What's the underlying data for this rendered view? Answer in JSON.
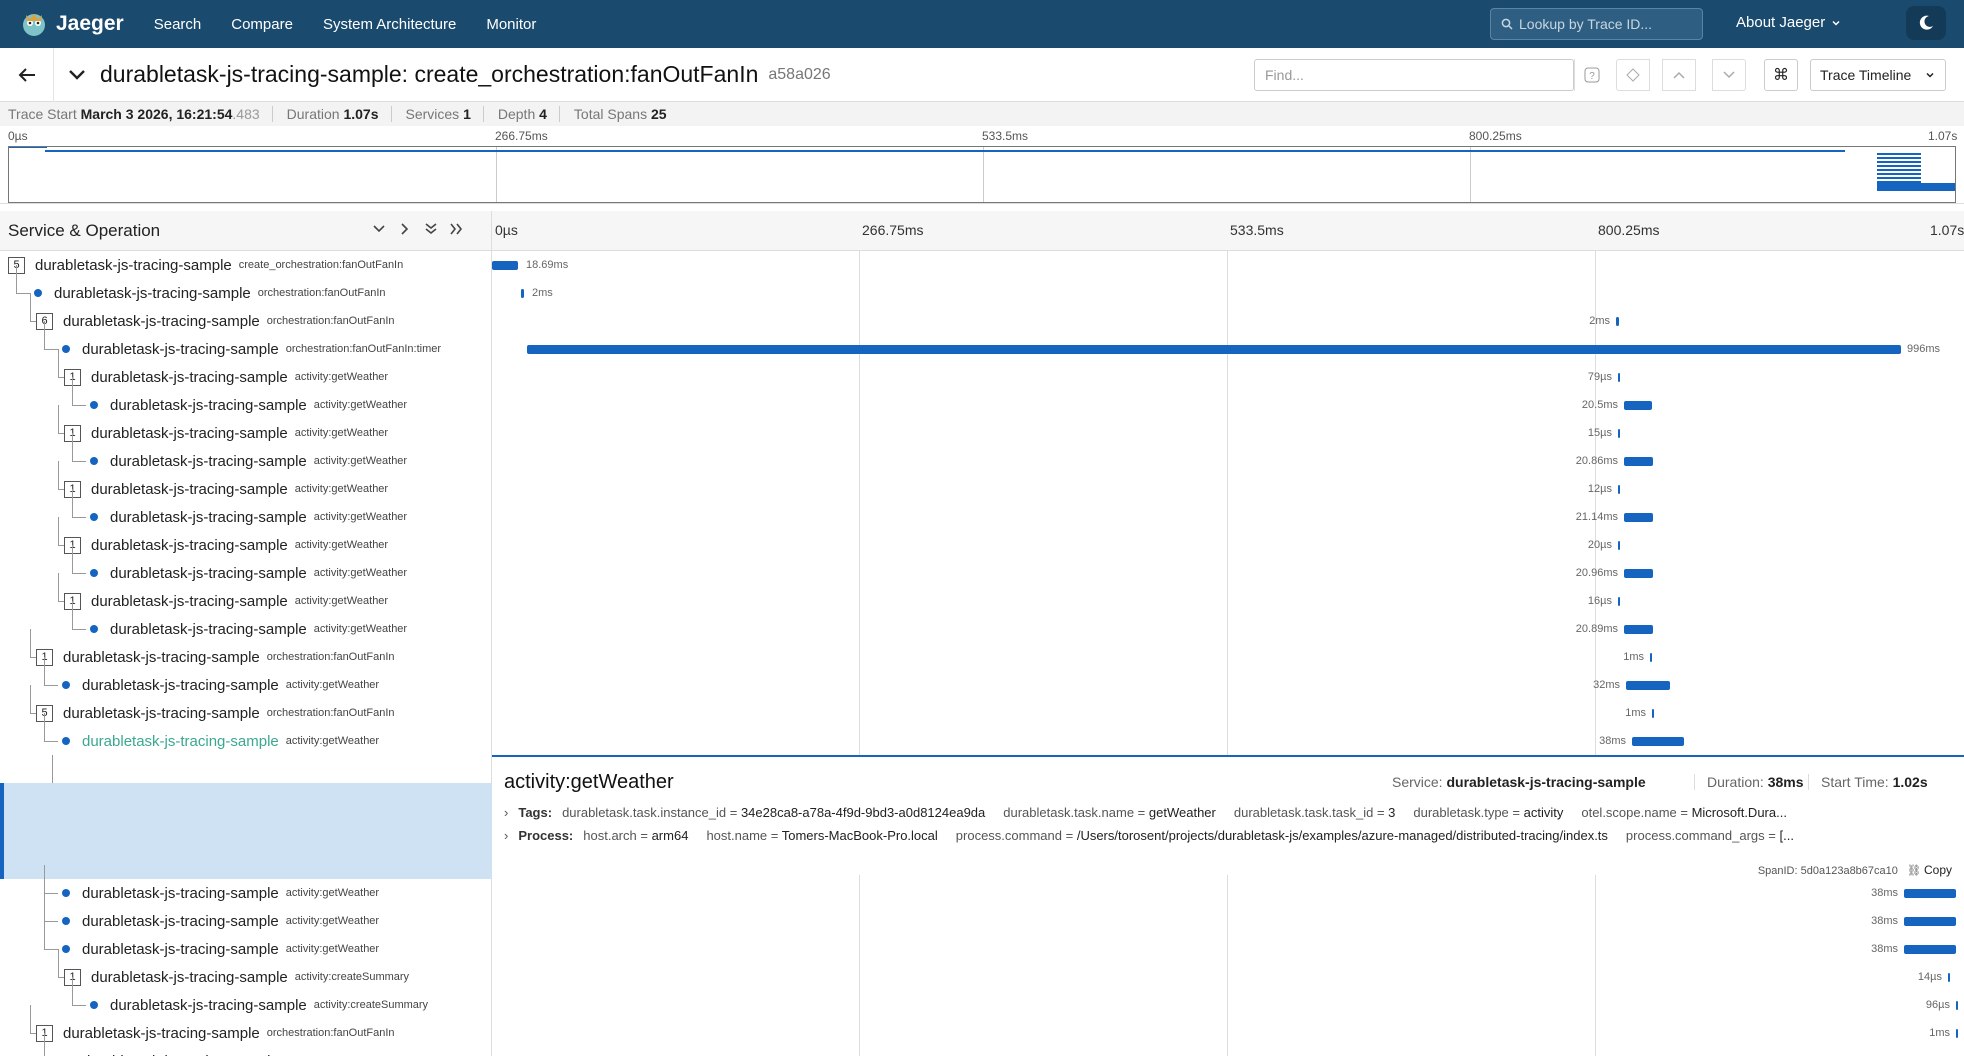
{
  "nav": {
    "brand": "Jaeger",
    "links": [
      "Search",
      "Compare",
      "System Architecture",
      "Monitor"
    ],
    "lookup_placeholder": "Lookup by Trace ID...",
    "about": "About Jaeger"
  },
  "header": {
    "title": "durabletask-js-tracing-sample: create_orchestration:fanOutFanIn",
    "trace_id": "a58a026",
    "find_placeholder": "Find...",
    "view": "Trace Timeline"
  },
  "meta": {
    "trace_start_label": "Trace Start",
    "trace_start": "March 3 2026, 16:21:54",
    "trace_start_ms": ".483",
    "duration_label": "Duration",
    "duration": "1.07s",
    "services_label": "Services",
    "services": "1",
    "depth_label": "Depth",
    "depth": "4",
    "spans_label": "Total Spans",
    "spans": "25"
  },
  "ticks": [
    "0µs",
    "266.75ms",
    "533.5ms",
    "800.25ms",
    "1.07s"
  ],
  "left_header": "Service & Operation",
  "rows": [
    {
      "svc": "durabletask-js-tracing-sample",
      "op": "create_orchestration:fanOutFanIn",
      "badge": "5",
      "dur": "18.69ms"
    },
    {
      "svc": "durabletask-js-tracing-sample",
      "op": "orchestration:fanOutFanIn",
      "dur": "2ms"
    },
    {
      "svc": "durabletask-js-tracing-sample",
      "op": "orchestration:fanOutFanIn",
      "badge": "6",
      "dur": "2ms"
    },
    {
      "svc": "durabletask-js-tracing-sample",
      "op": "orchestration:fanOutFanIn:timer",
      "dur": "996ms"
    },
    {
      "svc": "durabletask-js-tracing-sample",
      "op": "activity:getWeather",
      "badge": "1",
      "dur": "79µs"
    },
    {
      "svc": "durabletask-js-tracing-sample",
      "op": "activity:getWeather",
      "dur": "20.5ms"
    },
    {
      "svc": "durabletask-js-tracing-sample",
      "op": "activity:getWeather",
      "badge": "1",
      "dur": "15µs"
    },
    {
      "svc": "durabletask-js-tracing-sample",
      "op": "activity:getWeather",
      "dur": "20.86ms"
    },
    {
      "svc": "durabletask-js-tracing-sample",
      "op": "activity:getWeather",
      "badge": "1",
      "dur": "12µs"
    },
    {
      "svc": "durabletask-js-tracing-sample",
      "op": "activity:getWeather",
      "dur": "21.14ms"
    },
    {
      "svc": "durabletask-js-tracing-sample",
      "op": "activity:getWeather",
      "badge": "1",
      "dur": "20µs"
    },
    {
      "svc": "durabletask-js-tracing-sample",
      "op": "activity:getWeather",
      "dur": "20.96ms"
    },
    {
      "svc": "durabletask-js-tracing-sample",
      "op": "activity:getWeather",
      "badge": "1",
      "dur": "16µs"
    },
    {
      "svc": "durabletask-js-tracing-sample",
      "op": "activity:getWeather",
      "dur": "20.89ms"
    },
    {
      "svc": "durabletask-js-tracing-sample",
      "op": "orchestration:fanOutFanIn",
      "badge": "1",
      "dur": "1ms"
    },
    {
      "svc": "durabletask-js-tracing-sample",
      "op": "activity:getWeather",
      "dur": "32ms"
    },
    {
      "svc": "durabletask-js-tracing-sample",
      "op": "orchestration:fanOutFanIn",
      "badge": "5",
      "dur": "1ms"
    },
    {
      "svc": "durabletask-js-tracing-sample",
      "op": "activity:getWeather",
      "dur": "38ms"
    }
  ],
  "rows2": [
    {
      "svc": "durabletask-js-tracing-sample",
      "op": "activity:getWeather",
      "dur": "38ms"
    },
    {
      "svc": "durabletask-js-tracing-sample",
      "op": "activity:getWeather",
      "dur": "38ms"
    },
    {
      "svc": "durabletask-js-tracing-sample",
      "op": "activity:getWeather",
      "dur": "38ms"
    },
    {
      "svc": "durabletask-js-tracing-sample",
      "op": "activity:createSummary",
      "badge": "1",
      "dur": "14µs"
    },
    {
      "svc": "durabletask-js-tracing-sample",
      "op": "activity:createSummary",
      "dur": "96µs"
    },
    {
      "svc": "durabletask-js-tracing-sample",
      "op": "orchestration:fanOutFanIn",
      "badge": "1",
      "dur": "1ms"
    },
    {
      "svc": "durabletask-js-tracing-sample",
      "op": ""
    }
  ],
  "detail": {
    "op": "activity:getWeather",
    "service_label": "Service:",
    "service": "durabletask-js-tracing-sample",
    "duration_label": "Duration:",
    "duration": "38ms",
    "start_label": "Start Time:",
    "start": "1.02s",
    "tags_label": "Tags:",
    "tags": [
      [
        "durabletask.task.instance_id",
        "34e28ca8-a78a-4f9d-9bd3-a0d8124ea9da"
      ],
      [
        "durabletask.task.name",
        "getWeather"
      ],
      [
        "durabletask.task.task_id",
        "3"
      ],
      [
        "durabletask.type",
        "activity"
      ],
      [
        "otel.scope.name",
        "Microsoft.Dura..."
      ]
    ],
    "process_label": "Process:",
    "process": [
      [
        "host.arch",
        "arm64"
      ],
      [
        "host.name",
        "Tomers-MacBook-Pro.local"
      ],
      [
        "process.command",
        "/Users/torosent/projects/durabletask-js/examples/azure-managed/distributed-tracing/index.ts"
      ],
      [
        "process.command_args",
        "[..."
      ]
    ],
    "span_id_label": "SpanID:",
    "span_id": "5d0a123a8b67ca10",
    "copy": "Copy"
  }
}
